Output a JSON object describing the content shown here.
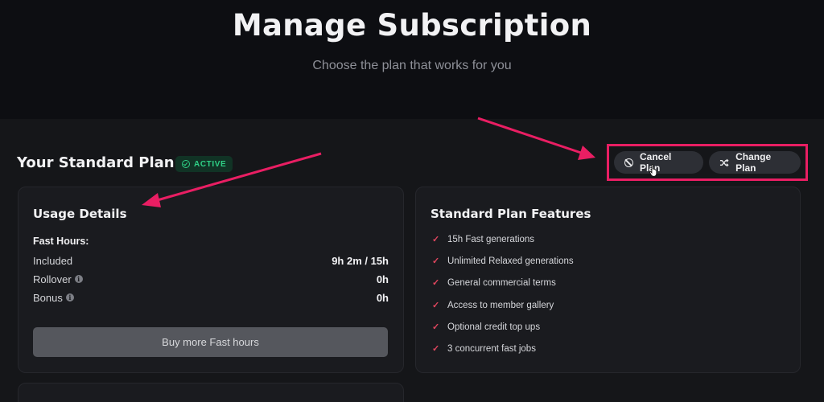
{
  "header": {
    "title": "Manage Subscription",
    "subtitle": "Choose the plan that works for you"
  },
  "plan": {
    "title": "Your Standard Plan",
    "status_badge": "ACTIVE",
    "cancel_label": "Cancel Plan",
    "change_label": "Change Plan"
  },
  "usage": {
    "title": "Usage Details",
    "fast_hours_label": "Fast Hours:",
    "rows": [
      {
        "label": "Included",
        "value": "9h 2m / 15h"
      },
      {
        "label": "Rollover",
        "value": "0h"
      },
      {
        "label": "Bonus",
        "value": "0h"
      }
    ],
    "buy_label": "Buy more Fast hours"
  },
  "features": {
    "title": "Standard Plan Features",
    "items": [
      "15h Fast generations",
      "Unlimited Relaxed generations",
      "General commercial terms",
      "Access to member gallery",
      "Optional credit top ups",
      "3 concurrent fast jobs"
    ]
  },
  "colors": {
    "accent_pink": "#e91e63",
    "active_green": "#2fd086",
    "check_red": "#e0465e"
  }
}
